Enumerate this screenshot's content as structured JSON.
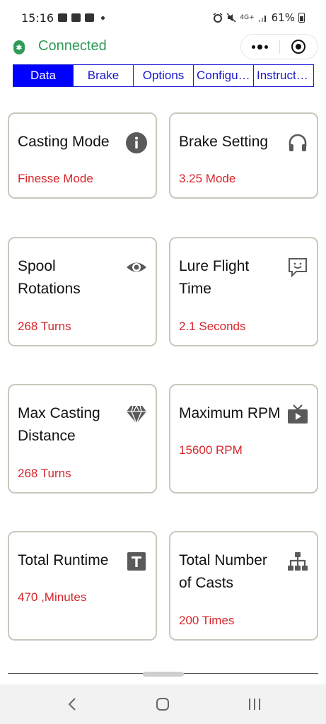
{
  "status_bar": {
    "time": "15:16",
    "network": "4G+",
    "battery": "61%"
  },
  "header": {
    "connection_status": "Connected",
    "connection_color": "#2f9a57"
  },
  "tabs": [
    {
      "label": "Data",
      "active": true
    },
    {
      "label": "Brake",
      "active": false
    },
    {
      "label": "Options",
      "active": false
    },
    {
      "label": "Configuration",
      "active": false
    },
    {
      "label": "Instructions",
      "active": false
    }
  ],
  "cards": [
    {
      "title": "Casting Mode",
      "value": "Finesse Mode",
      "icon": "info-icon"
    },
    {
      "title": "Brake Setting",
      "value": "3.25 Mode",
      "icon": "headphones-icon"
    },
    {
      "title": "Spool Rotations",
      "value": "268 Turns",
      "icon": "eye-icon"
    },
    {
      "title": "Lure Flight Time",
      "value": "2.1 Seconds",
      "icon": "smile-message-icon"
    },
    {
      "title": "Max Casting Distance",
      "value": "268 Turns",
      "icon": "diamond-icon"
    },
    {
      "title": "Maximum RPM",
      "value": "15600 RPM",
      "icon": "tv-icon"
    },
    {
      "title": "Total Runtime",
      "value": "470 ,Minutes",
      "icon": "text-t-icon"
    },
    {
      "title": "Total Number of Casts",
      "value": "200 Times",
      "icon": "hierarchy-icon"
    }
  ],
  "colors": {
    "tab_accent": "#0000ff",
    "value_text": "#d7262b",
    "card_border": "#c9c8bd",
    "icon_gray": "#5a5a5a"
  }
}
